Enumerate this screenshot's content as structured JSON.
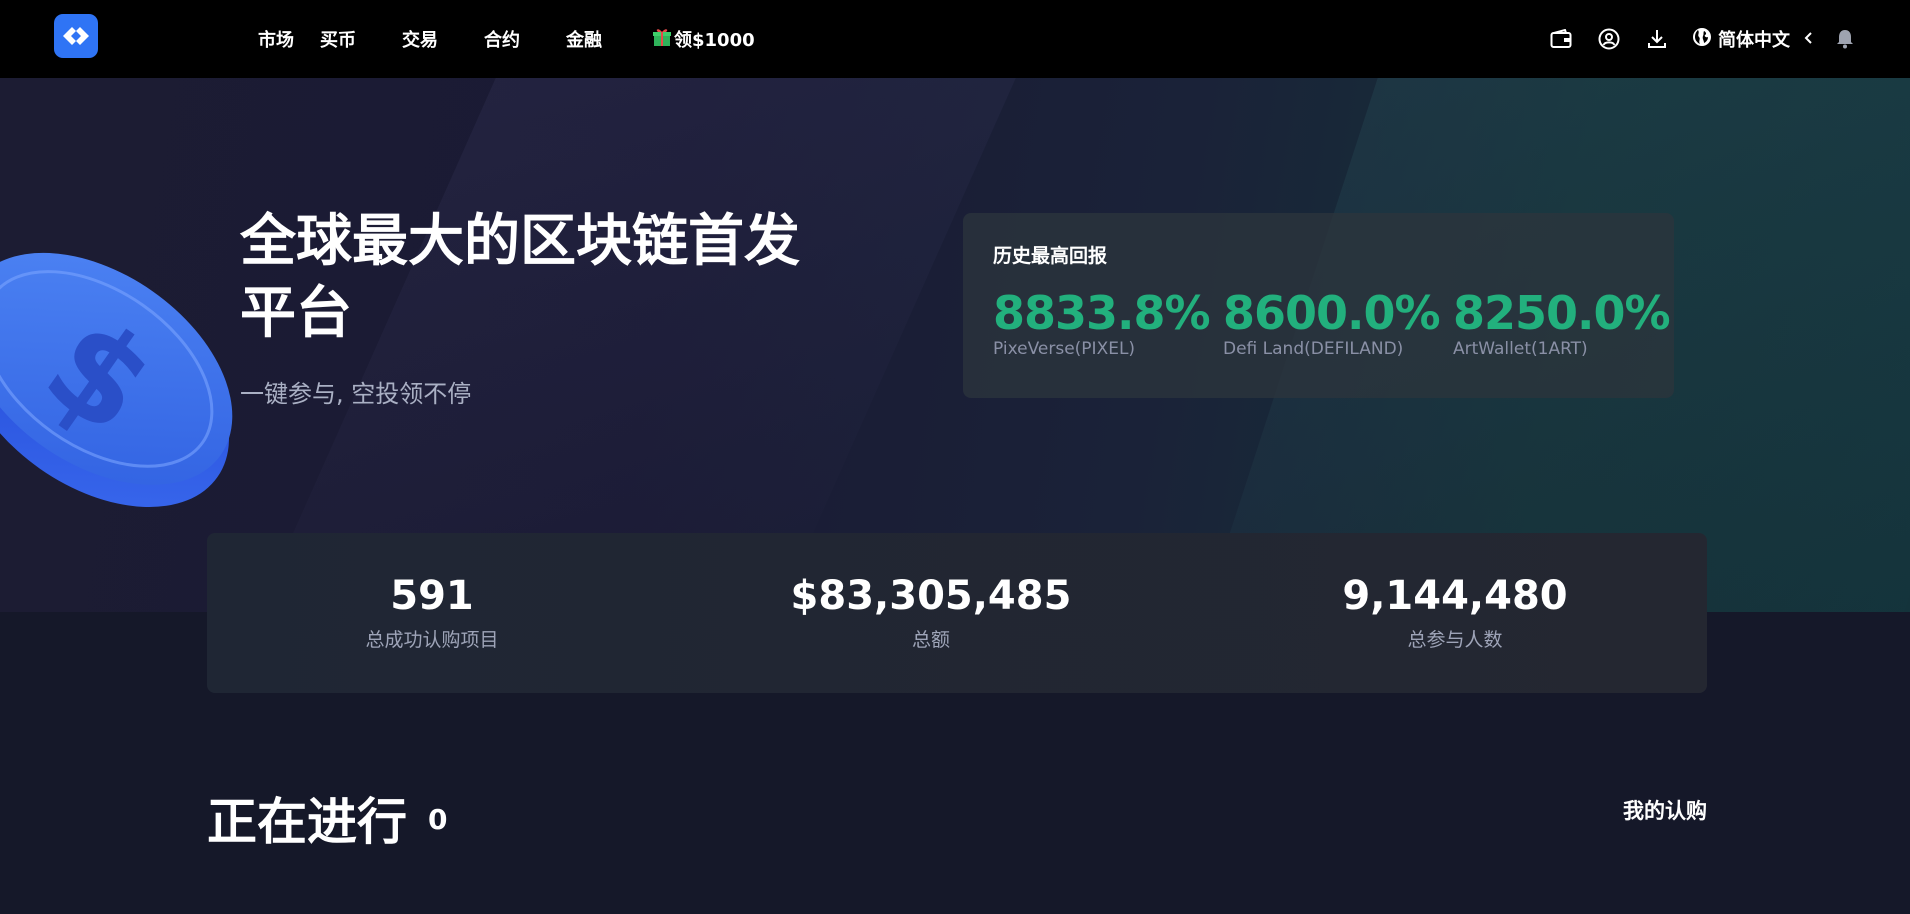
{
  "nav": {
    "items": [
      "市场",
      "买币",
      "交易",
      "合约",
      "金融"
    ],
    "promo": "领$1000"
  },
  "header": {
    "language": "简体中文"
  },
  "hero": {
    "title": "全球最大的区块链首发平台",
    "subtitle": "一键参与, 空投领不停"
  },
  "returns": {
    "title": "历史最高回报",
    "items": [
      {
        "value": "8833.8%",
        "name": "PixeVerse(PIXEL)"
      },
      {
        "value": "8600.0%",
        "name": "Defi Land(DEFILAND)"
      },
      {
        "value": "8250.0%",
        "name": "ArtWallet(1ART)"
      }
    ]
  },
  "stats": [
    {
      "value": "591",
      "label": "总成功认购项目"
    },
    {
      "value": "$83,305,485",
      "label": "总额"
    },
    {
      "value": "9,144,480",
      "label": "总参与人数"
    }
  ],
  "ongoing": {
    "title": "正在进行",
    "count": "0",
    "my_subscriptions": "我的认购"
  },
  "colors": {
    "brand": "#2f74f5",
    "accent_green": "#22b07d",
    "topbar": "#000000",
    "background": "#151829"
  },
  "icons": [
    "logo-icon",
    "gift-icon",
    "wallet-icon",
    "user-icon",
    "download-icon",
    "globe-icon",
    "chevron-left-icon",
    "bell-icon"
  ]
}
